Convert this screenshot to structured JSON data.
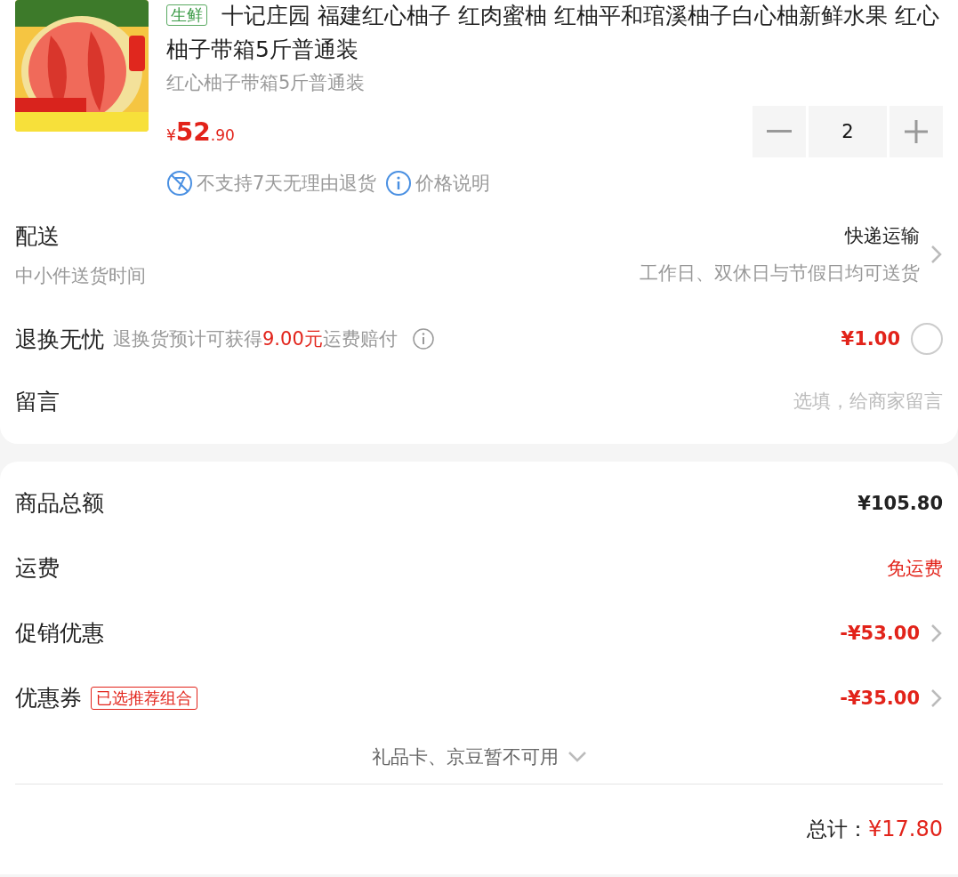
{
  "product": {
    "tag": "生鲜",
    "title": "十记庄园 福建红心柚子 红肉蜜柚 红柚平和琯溪柚子白心柚新鲜水果 红心柚子带箱5斤普通装",
    "spec": "红心柚子带箱5斤普通装",
    "price": {
      "currency": "¥",
      "integer": "52",
      "decimal": ".90"
    },
    "quantity": "2",
    "notes": [
      {
        "kind": "no-return",
        "text": "不支持7天无理由退货"
      },
      {
        "kind": "info",
        "text": "价格说明"
      }
    ]
  },
  "delivery": {
    "label": "配送",
    "sublabel": "中小件送货时间",
    "method": "快递运输",
    "time_note": "工作日、双休日与节假日均可送货"
  },
  "return_insurance": {
    "label": "退换无忧",
    "text_before": "退换货预计可获得",
    "highlight": "9.00元",
    "text_after": "运费赔付",
    "price": "¥1.00",
    "checked": false
  },
  "message": {
    "label": "留言",
    "placeholder": "选填，给商家留言"
  },
  "summary": {
    "rows": [
      {
        "label": "商品总额",
        "value": "¥105.80",
        "kind": "plain",
        "chevron": false
      },
      {
        "label": "运费",
        "value": "免运费",
        "kind": "free",
        "chevron": false
      },
      {
        "label": "促销优惠",
        "value": "-¥53.00",
        "kind": "discount",
        "chevron": true
      },
      {
        "label": "优惠券",
        "badge": "已选推荐组合",
        "value": "-¥35.00",
        "kind": "discount",
        "chevron": true
      }
    ],
    "gift_note": "礼品卡、京豆暂不可用",
    "total_label": "总计：",
    "total": "¥17.80"
  }
}
